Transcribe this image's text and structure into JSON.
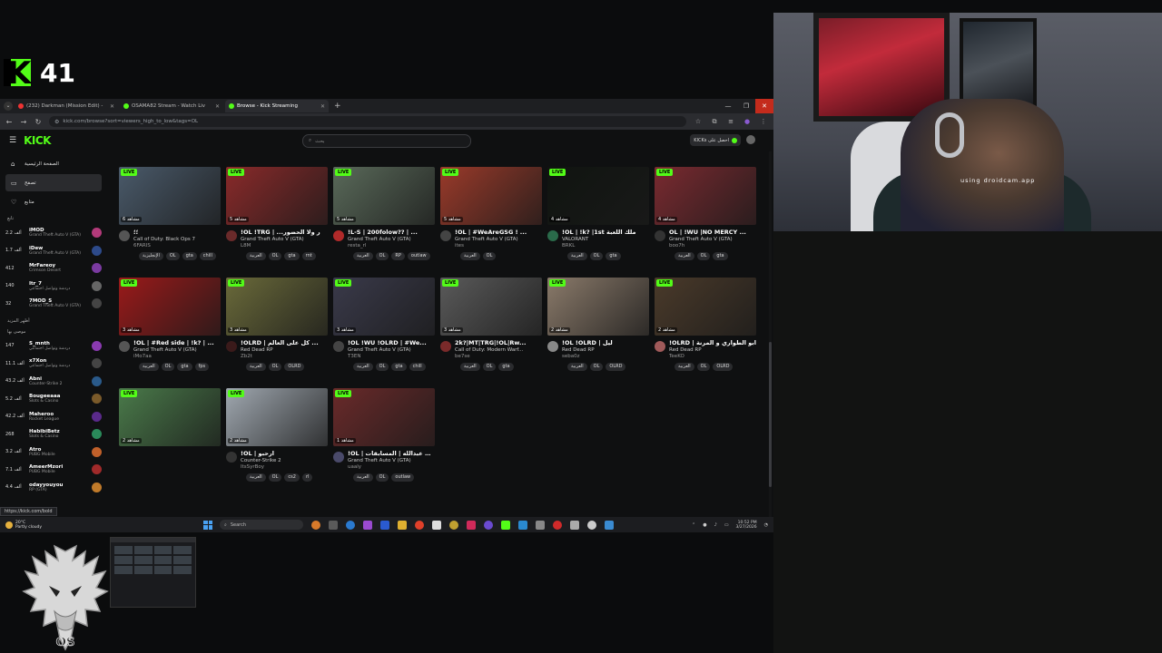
{
  "overlay": {
    "count": "41"
  },
  "browser": {
    "tabs": [
      {
        "label": "(232) Darkman (Mission Edit) -",
        "color": "#e33",
        "active": false
      },
      {
        "label": "OSAMA82 Stream - Watch Liv",
        "color": "#53fc18",
        "active": false
      },
      {
        "label": "Browse - Kick Streaming",
        "color": "#53fc18",
        "active": true
      }
    ],
    "url": "kick.com/browse?sort=viewers_high_to_low&tags=OL"
  },
  "header": {
    "logo": "KICK",
    "search_placeholder": "بحث",
    "kicks_label": "KICKs احصل على"
  },
  "sidebar": {
    "nav": [
      {
        "label": "الصفحة الرئيسية",
        "icon": "⌂"
      },
      {
        "label": "تصفح",
        "icon": "▭"
      },
      {
        "label": "متابع",
        "icon": "♡"
      }
    ],
    "section_following": "تابع",
    "channels_a": [
      {
        "viewers": "2.2 ألف",
        "name": "iMOD",
        "cat": "Grand Theft Auto V (GTA)",
        "color": "#b33a7a"
      },
      {
        "viewers": "1.7 ألف",
        "name": "iDew",
        "cat": "Grand Theft Auto V (GTA)",
        "color": "#2d4a8a"
      },
      {
        "viewers": "412",
        "name": "MrFareoy",
        "cat": "Crimson Desert",
        "color": "#7a3aa0"
      },
      {
        "viewers": "140",
        "name": "Itr_7",
        "cat": "دردشة وتواصل اجتماعي",
        "color": "#666"
      },
      {
        "viewers": "32",
        "name": "7MOD_S",
        "cat": "Grand Theft Auto V (GTA)",
        "color": "#444"
      }
    ],
    "section_recommended": "أظهر المزيد",
    "section_suggested": "موصى بها",
    "channels_b": [
      {
        "viewers": "147",
        "name": "S_mnth",
        "cat": "دردشة وتواصل اجتماعي",
        "color": "#8a3ab0"
      },
      {
        "viewers": "11.1 ألف",
        "name": "x7Xon",
        "cat": "دردشة وتواصل اجتماعي",
        "color": "#444"
      },
      {
        "viewers": "43.2 ألف",
        "name": "Abni",
        "cat": "Counter-Strike 2",
        "color": "#2a5a8a"
      },
      {
        "viewers": "5.2 ألف",
        "name": "Bougeeaaa",
        "cat": "Slots & Casino",
        "color": "#7a5a2a"
      },
      {
        "viewers": "42.2 ألف",
        "name": "Maheroo",
        "cat": "Rocket League",
        "color": "#5a2a8a"
      },
      {
        "viewers": "268",
        "name": "HabibiBetz",
        "cat": "Slots & Casino",
        "color": "#2a8a5a"
      },
      {
        "viewers": "3.2 ألف",
        "name": "Atro",
        "cat": "PUBG Mobile",
        "color": "#c0602a"
      },
      {
        "viewers": "7.1 ألف",
        "name": "AmeerMzori",
        "cat": "PUBG Mobile",
        "color": "#a02a2a"
      },
      {
        "viewers": "4.4 ألف",
        "name": "odayyouyou",
        "cat": "RP (GTA)",
        "color": "#c07a2a"
      }
    ]
  },
  "live_label": "LIVE",
  "cards": [
    {
      "views": "6 مشاهد",
      "title": "؛؛",
      "cat": "Call of Duty: Black Ops 7",
      "user": "6FARIS",
      "tags": [
        "الإنجليزية",
        "OL",
        "gta",
        "chill"
      ],
      "thumb": "#4a5a6a",
      "av": "#555"
    },
    {
      "views": "5 مشاهد",
      "title": "!OL !TRG | ...ر ولا الحضور",
      "cat": "Grand Theft Auto V (GTA)",
      "user": "L8M",
      "tags": [
        "العربية",
        "OL",
        "gta",
        "rnt"
      ],
      "thumb": "#8a2a2a",
      "av": "#6a2a2a"
    },
    {
      "views": "5 مشاهد",
      "title": "!L-S | 200folow?? | ...",
      "cat": "Grand Theft Auto V (GTA)",
      "user": "resta_rl",
      "tags": [
        "العربية",
        "OL",
        "RP",
        "outlaw"
      ],
      "thumb": "#5a6a5a",
      "av": "#b02a2a"
    },
    {
      "views": "5 مشاهد",
      "title": "!OL | #WeAreGSG ! ...",
      "cat": "Grand Theft Auto V (GTA)",
      "user": "ites",
      "tags": [
        "العربية",
        "OL"
      ],
      "thumb": "#9a3a2a",
      "av": "#444"
    },
    {
      "views": "4 مشاهد",
      "title": "!OL | !k? |1st ملك اللعبة",
      "cat": "VALORANT",
      "user": "BRKL",
      "tags": [
        "العربية",
        "OL",
        "gta"
      ],
      "thumb": "#101410",
      "av": "#2a6a4a"
    },
    {
      "views": "4 مشاهد",
      "title": "OL | !WU |NO MERCY ...",
      "cat": "Grand Theft Auto V (GTA)",
      "user": "boo7h",
      "tags": [
        "العربية",
        "OL",
        "gta"
      ],
      "thumb": "#7a2a30",
      "av": "#333"
    },
    {
      "views": "3 مشاهد",
      "title": "!OL | #Red side | !k? | ...",
      "cat": "Grand Theft Auto V (GTA)",
      "user": "iMo7aa",
      "tags": [
        "العربية",
        "OL",
        "gta",
        "fps"
      ],
      "thumb": "#9a1a1a",
      "av": "#555"
    },
    {
      "views": "3 مشاهد",
      "title": "!OLRD | كل على العالم ...",
      "cat": "Red Dead RP",
      "user": "Zb2t",
      "tags": [
        "العربية",
        "OL",
        "OLRD"
      ],
      "thumb": "#6a6a3a",
      "av": "#3a1a1a"
    },
    {
      "views": "3 مشاهد",
      "title": "!OL !WU !OLRD | #We...",
      "cat": "Grand Theft Auto V (GTA)",
      "user": "T3EN",
      "tags": [
        "العربية",
        "OL",
        "gta",
        "chill"
      ],
      "thumb": "#3a3a4a",
      "av": "#444"
    },
    {
      "views": "3 مشاهد",
      "title": "2k?|MT|TRG|!OL|Rw...",
      "cat": "Call of Duty: Modern Warf...",
      "user": "be7se",
      "tags": [
        "العربية",
        "OL",
        "gta"
      ],
      "thumb": "#5a5a5a",
      "av": "#7a2a2a"
    },
    {
      "views": "2 مشاهد",
      "title": "!OL !OLRD | ليل",
      "cat": "Red Dead RP",
      "user": "seba0z",
      "tags": [
        "العربية",
        "OL",
        "OLRD"
      ],
      "thumb": "#8a7a6a",
      "av": "#888"
    },
    {
      "views": "2 مشاهد",
      "title": "!OLRD | ابو الطواري و المرنة",
      "cat": "Red Dead RP",
      "user": "TeeKO",
      "tags": [
        "العربية",
        "OL",
        "OLRD"
      ],
      "thumb": "#4a3a2a",
      "av": "#a05a5a"
    },
    {
      "views": "2 مشاهد",
      "title": "",
      "cat": "",
      "user": "",
      "tags": [],
      "thumb": "#4a7a4a",
      "av": "#333"
    },
    {
      "views": "2 مشاهد",
      "title": "!OL | ارحبو",
      "cat": "Counter-Strike 2",
      "user": "ItsSyrBoy",
      "tags": [
        "العربية",
        "OL",
        "cs2",
        "rl"
      ],
      "thumb": "#a0a8b0",
      "av": "#333"
    },
    {
      "views": "1 مشاهد",
      "title": "!OL | راكان عبدالله | المسابقات",
      "cat": "Grand Theft Auto V (GTA)",
      "user": "uaaly",
      "tags": [
        "العربية",
        "OL",
        "outlaw"
      ],
      "thumb": "#6a2a2a",
      "av": "#4a4a6a"
    }
  ],
  "status_url": "https://kick.com/bold",
  "taskbar": {
    "weather_temp": "20°C",
    "weather_desc": "Partly cloudy",
    "search_label": "Search",
    "time": "10:52 PM",
    "date": "3/27/2026"
  },
  "webcam_caption": "using droidcam.app"
}
